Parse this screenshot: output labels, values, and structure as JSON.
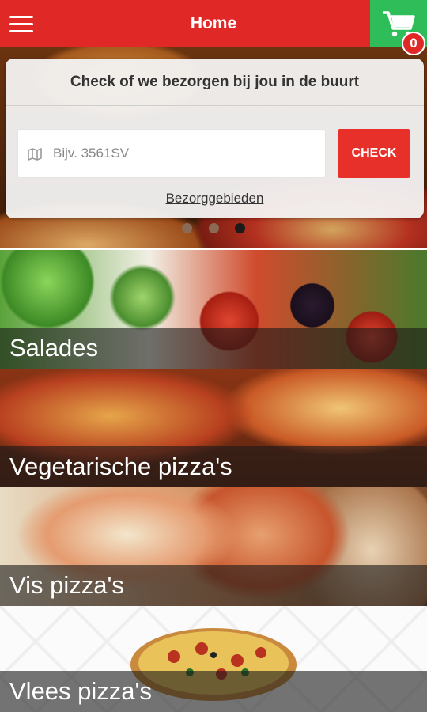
{
  "header": {
    "title": "Home",
    "menu_icon": "hamburger-menu-icon",
    "cart_icon": "shopping-cart-icon",
    "cart_count": "0",
    "colors": {
      "bar": "#e02826",
      "cart": "#2fbd5a"
    }
  },
  "hero": {
    "slides": 3,
    "active_slide": 3
  },
  "delivery_check": {
    "title": "Check of we bezorgen bij jou in de buurt",
    "input_placeholder": "Bijv. 3561SV",
    "input_value": "",
    "input_icon": "map-icon",
    "button_label": "CHECK",
    "link_label": "Bezorggebieden",
    "button_color": "#e8302b"
  },
  "categories": [
    {
      "label": "Salades"
    },
    {
      "label": "Vegetarische pizza's"
    },
    {
      "label": "Vis pizza's"
    },
    {
      "label": "Vlees pizza's"
    }
  ]
}
